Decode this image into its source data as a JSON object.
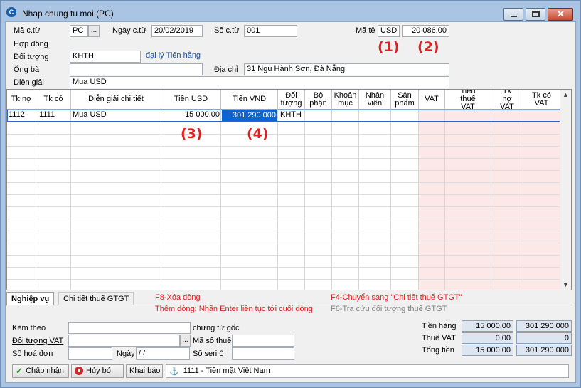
{
  "window": {
    "title": "Nhap chung tu moi (PC)",
    "app_icon": "C",
    "controls": [
      "minimize-icon",
      "maximize-icon",
      "close-icon"
    ]
  },
  "header": {
    "ma_ct_label": "Mã c.từ",
    "ma_ct_value": "PC",
    "ma_ct_browse": "...",
    "ngay_ct_label": "Ngày c.từ",
    "ngay_ct_value": "20/02/2019",
    "so_ct_label": "Số c.từ",
    "so_ct_value": "001",
    "ma_te_label": "Mã tệ",
    "ma_te_value": "USD",
    "ty_gia_value": "20 086.00",
    "hop_dong_label": "Hợp đồng",
    "hop_dong_value": "",
    "doi_tuong_label": "Đối tượng",
    "doi_tuong_value": "KHTH",
    "doi_tuong_name": "đại lý Tiến hằng",
    "ong_ba_label": "Ông bà",
    "ong_ba_value": "",
    "dia_chi_label": "Địa chỉ",
    "dia_chi_value": "31 Ngu Hành Sơn, Đà Nẵng",
    "dien_giai_label": "Diễn giải",
    "dien_giai_value": "Mua USD"
  },
  "annotations": {
    "a1": "(1)",
    "a2": "(2)",
    "a3": "(3)",
    "a4": "(4)"
  },
  "grid": {
    "columns": [
      "Tk nợ",
      "Tk có",
      "Diễn giải chi tiết",
      "Tiền USD",
      "Tiền VND",
      "Đối tượng",
      "Bộ phận",
      "Khoản mục",
      "Nhân viên",
      "Sản phẩm",
      "VAT",
      "Tiền thuế VAT",
      "Tk nợ VAT",
      "Tk có VAT"
    ],
    "rows": [
      {
        "tk_no": "1112",
        "tk_co": "1111",
        "dien_giai": "Mua USD",
        "tien_usd": "15 000.00",
        "tien_vnd": "301 290 000",
        "doi_tuong": "KHTH"
      }
    ]
  },
  "tabs": {
    "nghiep_vu": "Nghiệp vụ",
    "chi_tiet_thue": "Chi tiết thuế GTGT"
  },
  "hints": {
    "f8": "F8-Xóa dòng",
    "them_dong": "Thêm dòng: Nhấn Enter liên tục tới cuối dòng",
    "f4": "F4-Chuyển sang \"Chi tiết thuế GTGT\"",
    "f6": "F6-Tra cứu đối tượng thuế GTGT"
  },
  "footer": {
    "kem_theo_label": "Kèm theo",
    "kem_theo_value": "",
    "chung_tu_goc": "chứng từ gốc",
    "doi_tuong_vat_label": "Đối tượng VAT",
    "doi_tuong_vat_value": "",
    "doi_tuong_vat_browse": "...",
    "ma_so_thue_label": "Mã số thuế",
    "ma_so_thue_value": "",
    "so_hoa_don_label": "Số hoá đơn",
    "so_hoa_don_value": "",
    "ngay_label": "Ngày",
    "ngay_value": " /  /",
    "so_seri_label": "Số seri",
    "so_seri_value": "0",
    "so_seri_input": "",
    "tien_hang_label": "Tiền hàng",
    "tien_hang_usd": "15 000.00",
    "tien_hang_vnd": "301 290 000",
    "thue_vat_label": "Thuế VAT",
    "thue_vat_usd": "0.00",
    "thue_vat_vnd": "0",
    "tong_tien_label": "Tổng tiền",
    "tong_tien_usd": "15 000.00",
    "tong_tien_vnd": "301 290 000"
  },
  "buttons": {
    "chap_nhan": "Chấp nhận",
    "huy_bo": "Hủy bỏ",
    "khai_bao": "Khai báo"
  },
  "status": {
    "text": "1111 - Tiền mặt Việt Nam"
  },
  "colors": {
    "annotation": "#e02020",
    "selected_cell": "#0a64d2",
    "vat_columns": "#fde8e8",
    "link": "#1a4fa0"
  }
}
